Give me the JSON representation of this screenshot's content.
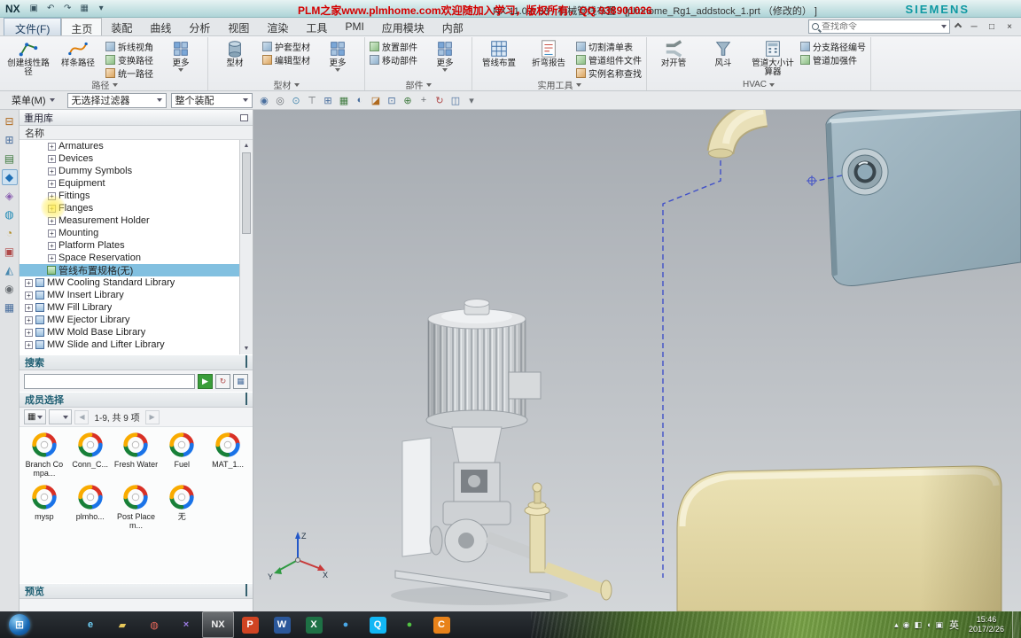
{
  "colors": {
    "brand_teal": "#0f99a2",
    "promo_red": "#d40000",
    "selection_blue": "#82c0e0"
  },
  "title_bar": {
    "app_badge": "NX",
    "quick_icons": [
      {
        "name": "save-icon",
        "glyph": "▣"
      },
      {
        "name": "undo-icon",
        "glyph": "↶"
      },
      {
        "name": "redo-icon",
        "glyph": "↷"
      },
      {
        "name": "window-layout-icon",
        "glyph": "▦"
      },
      {
        "name": "customize-qat-icon",
        "glyph": "▾"
      }
    ],
    "promo_text": "PLM之家www.plmhome.com欢迎随加入学习，版权所有，QQ 938901026",
    "window_title": "NX 11.0.0.33 - 机械管线布置 - [plmhome_Rg1_addstock_1.prt （修改的） ]",
    "brand": "SIEMENS"
  },
  "menu_bar": {
    "file_tab": "文件(F)",
    "tabs": [
      {
        "label": "主页",
        "active": true
      },
      {
        "label": "装配"
      },
      {
        "label": "曲线"
      },
      {
        "label": "分析"
      },
      {
        "label": "视图"
      },
      {
        "label": "渲染"
      },
      {
        "label": "工具"
      },
      {
        "label": "PMI"
      },
      {
        "label": "应用模块"
      },
      {
        "label": "内部"
      }
    ],
    "search_placeholder": "查找命令",
    "window_controls": {
      "minimize": "─",
      "restore": "□",
      "close": "×"
    }
  },
  "ribbon": {
    "groups": [
      {
        "label": "路径",
        "big": [
          "创建线性路径",
          "样条路径"
        ],
        "small": [
          "拆线视角",
          "变换路径",
          "统一路径"
        ],
        "more": "更多"
      },
      {
        "label": "型材",
        "big": [
          "型材"
        ],
        "small": [
          "护套型材",
          "编辑型材"
        ],
        "more": "更多"
      },
      {
        "label": "部件",
        "small": [
          "放置部件",
          "移动部件"
        ],
        "more": "更多"
      },
      {
        "label": "实用工具",
        "big": [
          "管线布置",
          "折弯报告"
        ],
        "small": [
          "切割清单表",
          "管道组件文件",
          "实例名称查找"
        ]
      },
      {
        "label": "HVAC",
        "big": [
          "对开管",
          "风斗",
          "管道大小计算器"
        ],
        "small": [
          "分支路径编号",
          "管道加强件"
        ]
      }
    ]
  },
  "selection_bar": {
    "menu_label": "菜单(M)",
    "filter_value": "无选择过滤器",
    "scope_value": "整个装配",
    "icons": [
      {
        "name": "snap-point-icon",
        "glyph": "◉",
        "fg": "#4a6f9e"
      },
      {
        "name": "touch-filter-icon",
        "glyph": "◎",
        "fg": "#6a6f74"
      },
      {
        "name": "interior-select-icon",
        "glyph": "⊙",
        "fg": "#4a8ab0"
      },
      {
        "name": "top-select-icon",
        "glyph": "⊤",
        "fg": "#6a6f74"
      },
      {
        "name": "window-select-icon",
        "glyph": "⊞",
        "fg": "#4a6f9e"
      },
      {
        "name": "wireframe-display-icon",
        "glyph": "▦",
        "fg": "#3f7a3f"
      },
      {
        "name": "shaded-display-icon",
        "glyph": "◐",
        "fg": "#4a6f9e"
      },
      {
        "name": "orient-view-icon",
        "glyph": "◪",
        "fg": "#b06a1f"
      },
      {
        "name": "fit-window-icon",
        "glyph": "⊡",
        "fg": "#4a6f9e"
      },
      {
        "name": "zoom-icon",
        "glyph": "⊕",
        "fg": "#3f7a3f"
      },
      {
        "name": "pan-icon",
        "glyph": "+",
        "fg": "#6a6f74"
      },
      {
        "name": "rotate-view-icon",
        "glyph": "↻",
        "fg": "#b04a4a"
      },
      {
        "name": "show-hide-icon",
        "glyph": "◫",
        "fg": "#4a6f9e"
      },
      {
        "name": "more-view-tools-icon",
        "glyph": "▾",
        "fg": "#6a6f74"
      }
    ]
  },
  "resource_bar": {
    "icons": [
      {
        "name": "assembly-navigator-icon",
        "glyph": "⊟",
        "fg": "#b06a1f"
      },
      {
        "name": "constraint-navigator-icon",
        "glyph": "⊞",
        "fg": "#4a6f9e"
      },
      {
        "name": "part-navigator-icon",
        "glyph": "▤",
        "fg": "#3f7a3f"
      },
      {
        "name": "reuse-library-icon",
        "glyph": "◆",
        "fg": "#1f6fb5",
        "active": true
      },
      {
        "name": "hd3d-tools-icon",
        "glyph": "◈",
        "fg": "#8a5fb0"
      },
      {
        "name": "web-browser-icon",
        "glyph": "◍",
        "fg": "#1f8ab5"
      },
      {
        "name": "history-icon",
        "glyph": "◔",
        "fg": "#b08a1f"
      },
      {
        "name": "process-studio-icon",
        "glyph": "▣",
        "fg": "#b04a4a"
      },
      {
        "name": "manufacturing-wizard-icon",
        "glyph": "◭",
        "fg": "#4a8ab0"
      },
      {
        "name": "roles-icon",
        "glyph": "◉",
        "fg": "#6a6f74"
      },
      {
        "name": "system-scenes-icon",
        "glyph": "▦",
        "fg": "#4a6f9e"
      }
    ]
  },
  "reuse_library": {
    "title": "重用库",
    "column_header": "名称",
    "items": [
      {
        "label": "Armatures",
        "depth": 2,
        "expander": "+"
      },
      {
        "label": "Devices",
        "depth": 2,
        "expander": "+"
      },
      {
        "label": "Dummy Symbols",
        "depth": 2,
        "expander": "+"
      },
      {
        "label": "Equipment",
        "depth": 2,
        "expander": "+"
      },
      {
        "label": "Fittings",
        "depth": 2,
        "expander": "+"
      },
      {
        "label": "Flanges",
        "depth": 2,
        "expander": "+",
        "highlight": true
      },
      {
        "label": "Measurement Holder",
        "depth": 2,
        "expander": "+"
      },
      {
        "label": "Mounting",
        "depth": 2,
        "expander": "+"
      },
      {
        "label": "Platform Plates",
        "depth": 2,
        "expander": "+"
      },
      {
        "label": "Space Reservation",
        "depth": 2,
        "expander": "+"
      },
      {
        "label": "管线布置规格(无)",
        "depth": 1,
        "icon": "spec",
        "selected": true
      },
      {
        "label": "MW Cooling Standard Library",
        "depth": 0,
        "expander": "+",
        "icon": "lib"
      },
      {
        "label": "MW Insert Library",
        "depth": 0,
        "expander": "+",
        "icon": "lib"
      },
      {
        "label": "MW Fill Library",
        "depth": 0,
        "expander": "+",
        "icon": "lib"
      },
      {
        "label": "MW Ejector Library",
        "depth": 0,
        "expander": "+",
        "icon": "lib"
      },
      {
        "label": "MW Mold Base Library",
        "depth": 0,
        "expander": "+",
        "icon": "lib"
      },
      {
        "label": "MW Slide and Lifter Library",
        "depth": 0,
        "expander": "+",
        "icon": "lib"
      }
    ]
  },
  "search_panel": {
    "title": "搜索",
    "input_value": "",
    "buttons": [
      {
        "name": "search-go-button",
        "glyph": "▶",
        "fg": "#ffffff",
        "bg": "#3a9d3a"
      },
      {
        "name": "search-reset-button",
        "glyph": "↻",
        "fg": "#b04a4a"
      },
      {
        "name": "search-settings-button",
        "glyph": "▦",
        "fg": "#4a6f9e"
      }
    ]
  },
  "member_select": {
    "title": "成员选择",
    "view_mode_glyph": "▦",
    "nav_prev": "◀",
    "nav_next": "▶",
    "range_text": "1-9, 共 9 项",
    "items": [
      {
        "label": "Branch Compa..."
      },
      {
        "label": "Conn_C..."
      },
      {
        "label": "Fresh Water"
      },
      {
        "label": "Fuel"
      },
      {
        "label": "MAT_1..."
      },
      {
        "label": "mysp"
      },
      {
        "label": "plmho..."
      },
      {
        "label": "Post Placem..."
      },
      {
        "label": "无"
      }
    ]
  },
  "preview_panel": {
    "title": "预览"
  },
  "viewport": {
    "triad": {
      "x": "X",
      "y": "Y",
      "z": "Z"
    }
  },
  "taskbar": {
    "icons": [
      {
        "name": "internet-explorer-icon",
        "glyph": "e",
        "fg": "#6ecff6"
      },
      {
        "name": "folder-icon",
        "glyph": "▰",
        "fg": "#e8c85a"
      },
      {
        "name": "chrome-icon",
        "glyph": "◍",
        "fg": "#e8685a"
      },
      {
        "name": "thunder-icon",
        "glyph": "×",
        "fg": "#9a7ae0"
      },
      {
        "name": "nx-session-icon",
        "glyph": "NX",
        "fg": "#f2f2f2",
        "active": true
      },
      {
        "name": "powerpoint-icon",
        "glyph": "P",
        "fg": "#ffffff",
        "bg": "#d04423"
      },
      {
        "name": "word-icon",
        "glyph": "W",
        "fg": "#ffffff",
        "bg": "#2b579a"
      },
      {
        "name": "excel-icon",
        "glyph": "X",
        "fg": "#ffffff",
        "bg": "#1e7145"
      },
      {
        "name": "browser-icon",
        "glyph": "●",
        "fg": "#4aa8e8"
      },
      {
        "name": "qq-icon",
        "glyph": "Q",
        "fg": "#ffffff",
        "bg": "#12b7f5"
      },
      {
        "name": "wechat-icon",
        "glyph": "●",
        "fg": "#52c343"
      },
      {
        "name": "caj-icon",
        "glyph": "C",
        "fg": "#ffffff",
        "bg": "#e8821a"
      }
    ],
    "tray_icons": [
      {
        "name": "tray-expand-icon",
        "glyph": "▴"
      },
      {
        "name": "tray-safety-icon",
        "glyph": "◉"
      },
      {
        "name": "tray-network-icon",
        "glyph": "◧"
      },
      {
        "name": "tray-volume-icon",
        "glyph": "◖"
      },
      {
        "name": "tray-message-icon",
        "glyph": "▣"
      }
    ],
    "lang": "英",
    "time": "15:46",
    "date": "2017/2/26"
  }
}
